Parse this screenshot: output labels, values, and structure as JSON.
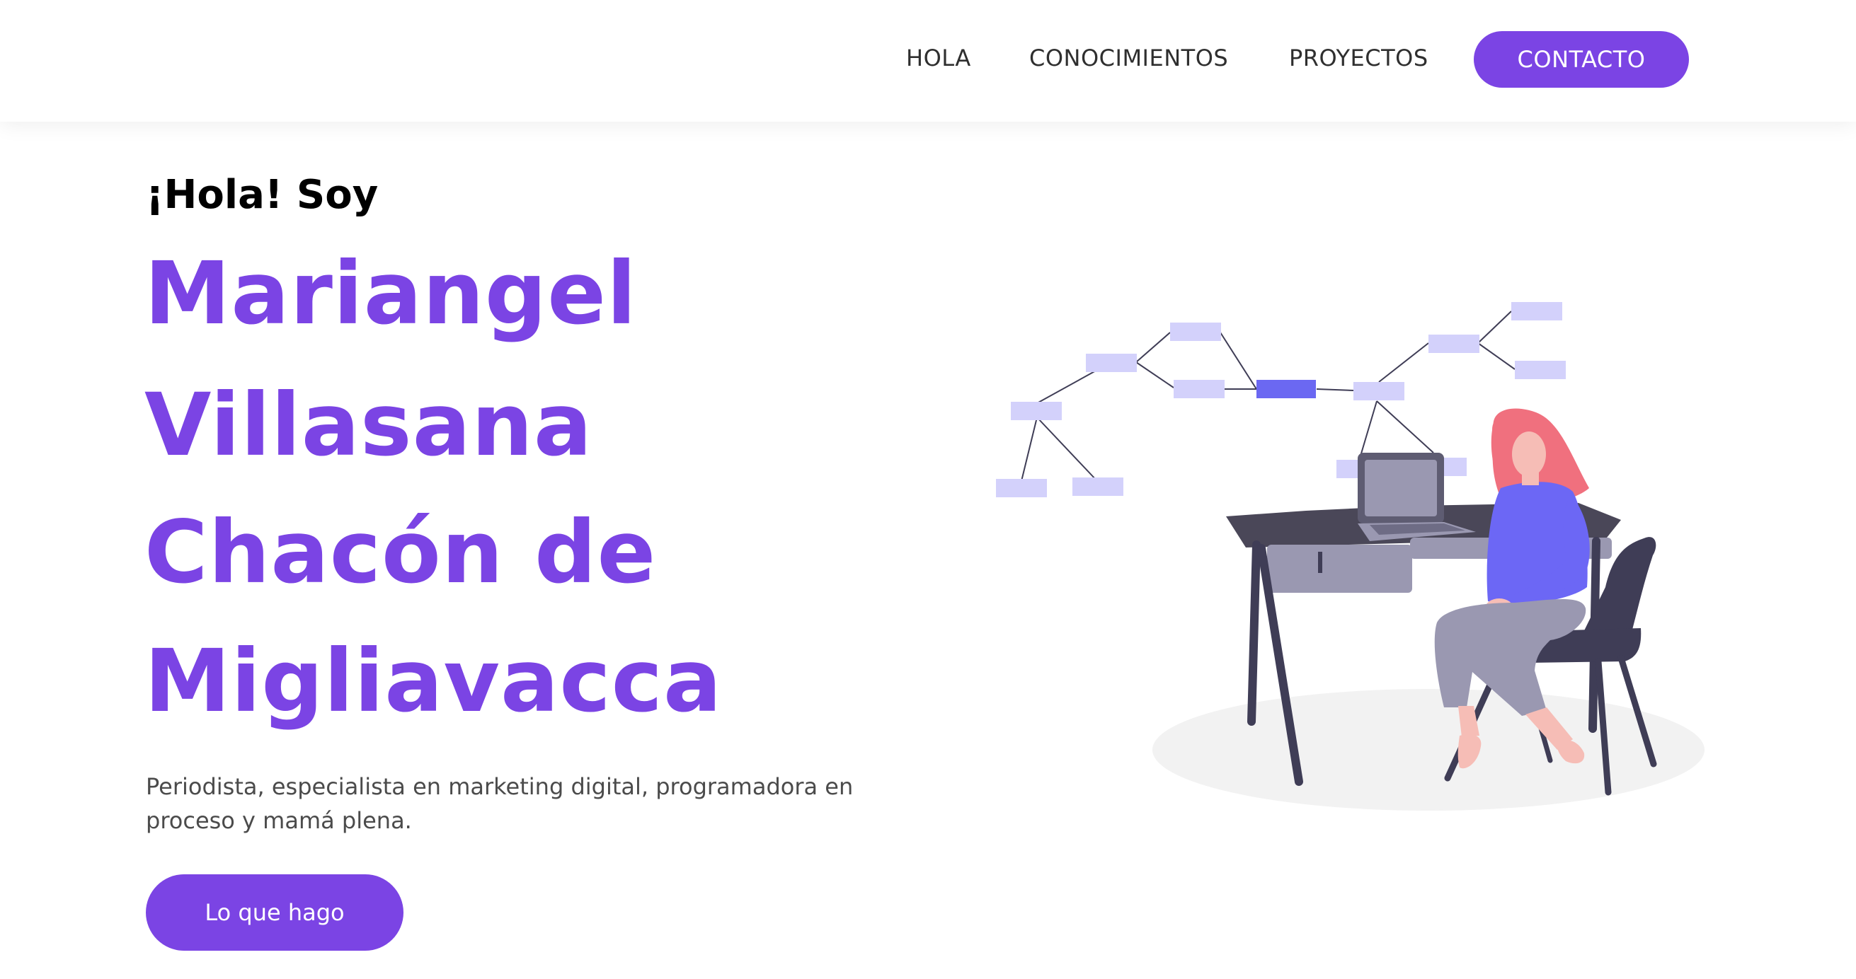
{
  "nav": {
    "items": [
      "HOLA",
      "CONOCIMIENTOS",
      "PROYECTOS"
    ],
    "cta": "CONTACTO"
  },
  "hero": {
    "greeting": "¡Hola! Soy",
    "name_lines": [
      "Mariangel",
      "Villasana",
      "Chacón de",
      "Migliavacca"
    ],
    "description": "Periodista, especialista en marketing digital, programadora en proceso y mamá plena.",
    "cta": "Lo que hago"
  },
  "illustration": {
    "subject": "woman-at-desk-with-laptop-and-mindmap"
  },
  "colors": {
    "accent": "#7b44e4",
    "mindmap_node": "#d3d1fb",
    "mindmap_node_active": "#6b68f2",
    "desk": "#4a4758",
    "hair": "#f0707e",
    "shirt": "#6c67f5",
    "pants": "#9a98b1",
    "skin": "#f6bdb6",
    "floor": "#f2f2f2"
  }
}
